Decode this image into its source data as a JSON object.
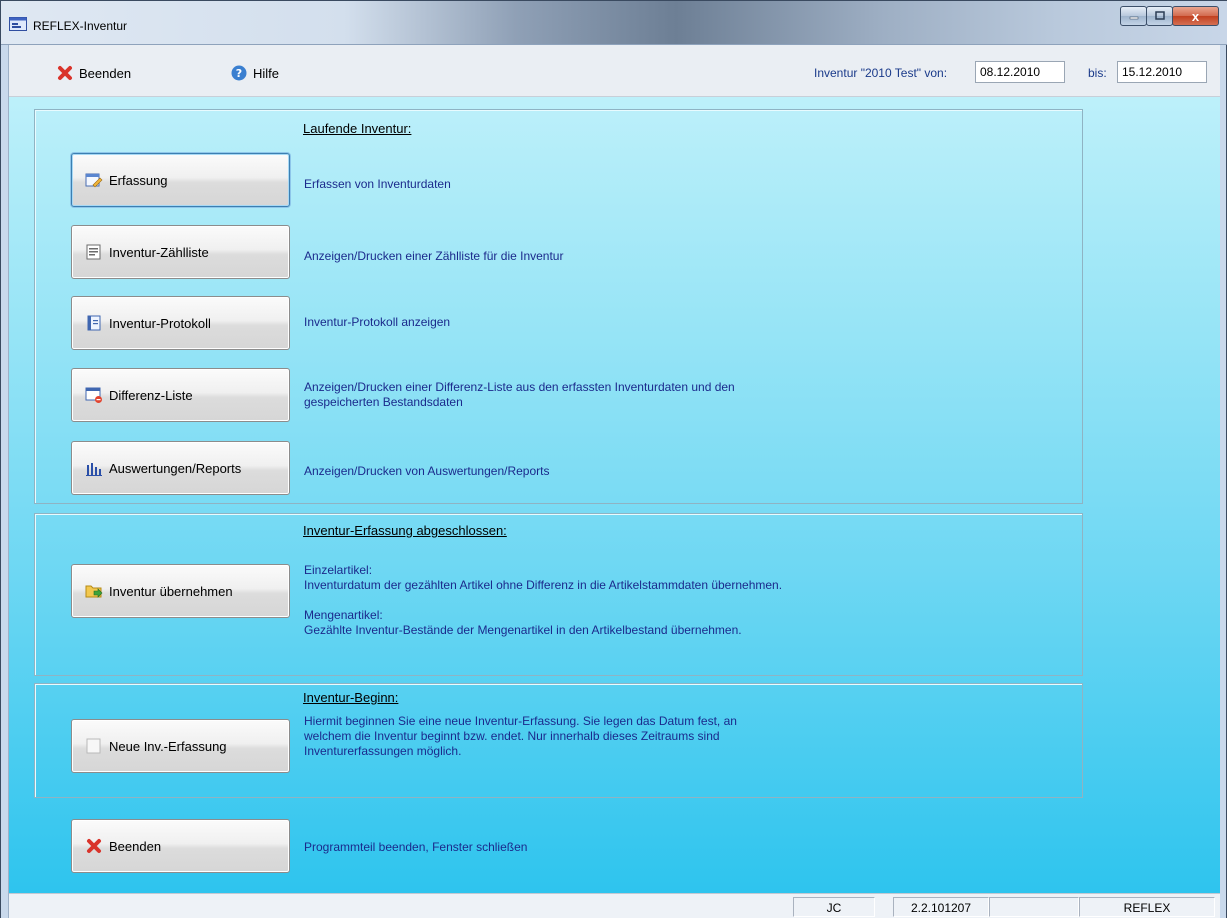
{
  "window": {
    "title": "REFLEX-Inventur",
    "controls": {
      "minimize_icon": "minimize-icon",
      "maximize_icon": "maximize-icon",
      "close_label": "x"
    }
  },
  "toolbar": {
    "exit_label": "Beenden",
    "help_label": "Hilfe",
    "inventory_label": "Inventur \"2010 Test\" von:",
    "from_date": "08.12.2010",
    "to_label": "bis:",
    "to_date": "15.12.2010"
  },
  "sections": {
    "running": {
      "title": "Laufende Inventur:",
      "items": [
        {
          "label": "Erfassung",
          "icon": "edit-form-icon",
          "description": "Erfassen von Inventurdaten"
        },
        {
          "label": "Inventur-Zählliste",
          "icon": "list-icon",
          "description": "Anzeigen/Drucken einer Zählliste für die Inventur"
        },
        {
          "label": "Inventur-Protokoll",
          "icon": "notebook-icon",
          "description": " Inventur-Protokoll anzeigen"
        },
        {
          "label": "Differenz-Liste",
          "icon": "window-minus-icon",
          "description": "Anzeigen/Drucken einer Differenz-Liste aus den erfassten Inventurdaten und den\ngespeicherten Bestandsdaten"
        },
        {
          "label": "Auswertungen/Reports",
          "icon": "bar-chart-icon",
          "description": "Anzeigen/Drucken von Auswertungen/Reports"
        }
      ]
    },
    "completed": {
      "title": "Inventur-Erfassung abgeschlossen:",
      "button_label": "Inventur übernehmen",
      "icon": "folder-arrow-icon",
      "description": "Einzelartikel:\nInventurdatum der gezählten Artikel ohne Differenz in die Artikelstammdaten übernehmen.\n\nMengenartikel:\nGezählte Inventur-Bestände der Mengenartikel in den Artikelbestand übernehmen."
    },
    "begin": {
      "title": "Inventur-Beginn:",
      "button_label": "Neue Inv.-Erfassung",
      "icon": "blank-page-icon",
      "description": "Hiermit beginnen Sie eine neue Inventur-Erfassung. Sie legen das Datum fest, an\nwelchem die Inventur beginnt bzw. endet. Nur innerhalb dieses Zeitraums sind\nInventurerfassungen möglich."
    },
    "exit": {
      "button_label": "Beenden",
      "icon": "close-x-icon",
      "description": "Programmteil beenden, Fenster schließen"
    }
  },
  "statusbar": {
    "user": "JC",
    "version": "2.2.101207",
    "empty": "",
    "app": "REFLEX"
  },
  "colors": {
    "description_text": "#1b2a8c",
    "main_gradient_top": "#bdf0fa",
    "main_gradient_bottom": "#2ec4ee",
    "close_red": "#d9342b",
    "help_blue": "#3a7fd0"
  }
}
